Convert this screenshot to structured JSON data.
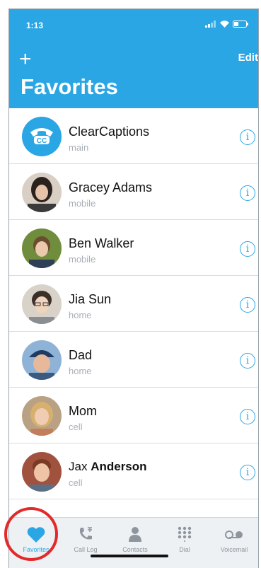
{
  "status": {
    "time": "1:13"
  },
  "header": {
    "add_label": "+",
    "edit_label": "Edit",
    "title": "Favorites"
  },
  "favorites": [
    {
      "first": "ClearCaptions",
      "last": "",
      "type": "main",
      "avatar_color": "#2aa6e5",
      "logo_text": "CC"
    },
    {
      "first": "Gracey Adams",
      "last": "",
      "type": "mobile",
      "avatar_color": "#4a3b35"
    },
    {
      "first": "Ben Walker",
      "last": "",
      "type": "mobile",
      "avatar_color": "#7a9b4a"
    },
    {
      "first": "Jia Sun",
      "last": "",
      "type": "home",
      "avatar_color": "#c9b8a6"
    },
    {
      "first": "Dad",
      "last": "",
      "type": "home",
      "avatar_color": "#5b7fa8"
    },
    {
      "first": "Mom",
      "last": "",
      "type": "cell",
      "avatar_color": "#c8a27a"
    },
    {
      "first": "Jax ",
      "last": "Anderson",
      "type": "cell",
      "avatar_color": "#a0523f"
    }
  ],
  "tabs": [
    {
      "label": "Favorites",
      "icon": "heart-icon"
    },
    {
      "label": "Call Log",
      "icon": "call-log-icon"
    },
    {
      "label": "Contacts",
      "icon": "person-icon"
    },
    {
      "label": "Dial",
      "icon": "keypad-icon"
    },
    {
      "label": "Voicemail",
      "icon": "voicemail-icon"
    }
  ],
  "colors": {
    "accent": "#2aa6e5",
    "highlight_circle": "#e32a2a"
  }
}
